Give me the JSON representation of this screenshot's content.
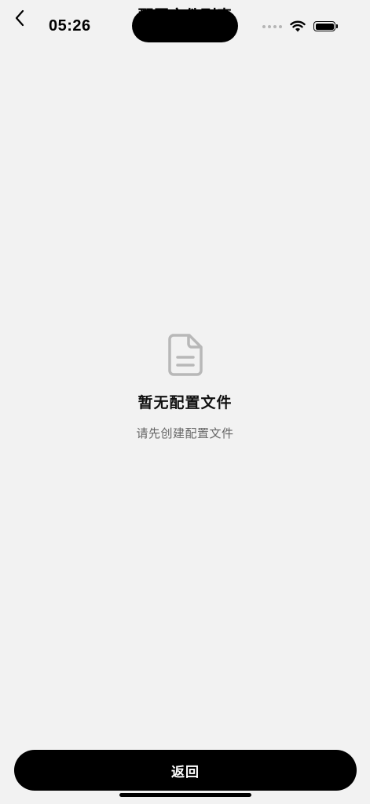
{
  "status_bar": {
    "time": "05:26"
  },
  "nav": {
    "title": "配置文件列表",
    "back_icon": "chevron-left-icon"
  },
  "empty_state": {
    "icon": "document-icon",
    "title": "暂无配置文件",
    "subtitle": "请先创建配置文件"
  },
  "footer": {
    "return_label": "返回"
  },
  "colors": {
    "background": "#f2f2f2",
    "button": "#000000",
    "icon_gray": "#b8b8b8",
    "subtitle": "#666666"
  }
}
